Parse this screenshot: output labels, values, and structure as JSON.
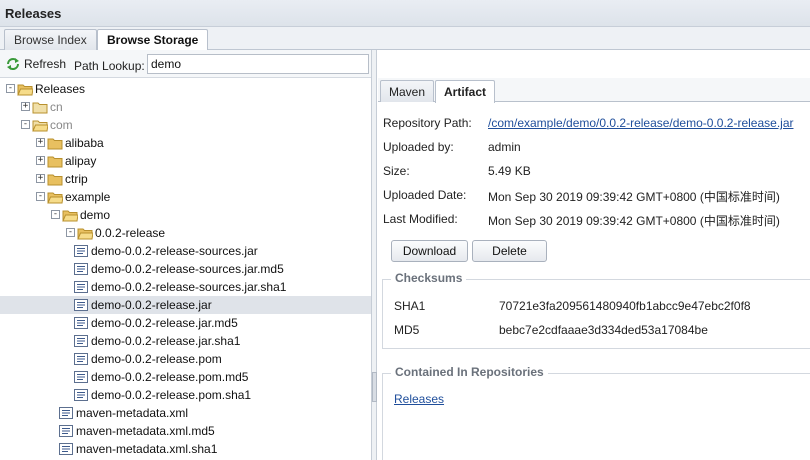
{
  "window": {
    "title": "Releases"
  },
  "main_tabs": [
    {
      "label": "Browse Index",
      "active": false
    },
    {
      "label": "Browse Storage",
      "active": true
    }
  ],
  "toolbar": {
    "refresh_label": "Refresh",
    "path_label": "Path Lookup:",
    "path_value": "demo"
  },
  "tree": [
    {
      "label": "Releases",
      "depth": 0,
      "kind": "folder-open",
      "toggle": "-",
      "dim": false,
      "selected": false
    },
    {
      "label": "cn",
      "depth": 1,
      "kind": "folder",
      "toggle": "+",
      "dim": true,
      "selected": false
    },
    {
      "label": "com",
      "depth": 1,
      "kind": "folder-open",
      "toggle": "-",
      "dim": true,
      "selected": false
    },
    {
      "label": "alibaba",
      "depth": 2,
      "kind": "folder",
      "toggle": "+",
      "dim": false,
      "selected": false
    },
    {
      "label": "alipay",
      "depth": 2,
      "kind": "folder",
      "toggle": "+",
      "dim": false,
      "selected": false
    },
    {
      "label": "ctrip",
      "depth": 2,
      "kind": "folder",
      "toggle": "+",
      "dim": false,
      "selected": false
    },
    {
      "label": "example",
      "depth": 2,
      "kind": "folder-open",
      "toggle": "-",
      "dim": false,
      "selected": false
    },
    {
      "label": "demo",
      "depth": 3,
      "kind": "folder-open",
      "toggle": "-",
      "dim": false,
      "selected": false
    },
    {
      "label": "0.0.2-release",
      "depth": 4,
      "kind": "folder-open",
      "toggle": "-",
      "dim": false,
      "selected": false
    },
    {
      "label": "demo-0.0.2-release-sources.jar",
      "depth": 5,
      "kind": "file",
      "toggle": "",
      "dim": false,
      "selected": false
    },
    {
      "label": "demo-0.0.2-release-sources.jar.md5",
      "depth": 5,
      "kind": "file",
      "toggle": "",
      "dim": false,
      "selected": false
    },
    {
      "label": "demo-0.0.2-release-sources.jar.sha1",
      "depth": 5,
      "kind": "file",
      "toggle": "",
      "dim": false,
      "selected": false
    },
    {
      "label": "demo-0.0.2-release.jar",
      "depth": 5,
      "kind": "file",
      "toggle": "",
      "dim": false,
      "selected": true
    },
    {
      "label": "demo-0.0.2-release.jar.md5",
      "depth": 5,
      "kind": "file",
      "toggle": "",
      "dim": false,
      "selected": false
    },
    {
      "label": "demo-0.0.2-release.jar.sha1",
      "depth": 5,
      "kind": "file",
      "toggle": "",
      "dim": false,
      "selected": false
    },
    {
      "label": "demo-0.0.2-release.pom",
      "depth": 5,
      "kind": "file",
      "toggle": "",
      "dim": false,
      "selected": false
    },
    {
      "label": "demo-0.0.2-release.pom.md5",
      "depth": 5,
      "kind": "file",
      "toggle": "",
      "dim": false,
      "selected": false
    },
    {
      "label": "demo-0.0.2-release.pom.sha1",
      "depth": 5,
      "kind": "file",
      "toggle": "",
      "dim": false,
      "selected": false
    },
    {
      "label": "maven-metadata.xml",
      "depth": 4,
      "kind": "file",
      "toggle": "",
      "dim": false,
      "selected": false
    },
    {
      "label": "maven-metadata.xml.md5",
      "depth": 4,
      "kind": "file",
      "toggle": "",
      "dim": false,
      "selected": false
    },
    {
      "label": "maven-metadata.xml.sha1",
      "depth": 4,
      "kind": "file",
      "toggle": "",
      "dim": false,
      "selected": false
    }
  ],
  "sub_tabs": [
    {
      "label": "Maven",
      "active": false
    },
    {
      "label": "Artifact",
      "active": true
    }
  ],
  "artifact": {
    "fields": [
      {
        "label": "Repository Path:",
        "value": "/com/example/demo/0.0.2-release/demo-0.0.2-release.jar",
        "link": true
      },
      {
        "label": "Uploaded by:",
        "value": "admin",
        "link": false
      },
      {
        "label": "Size:",
        "value": "5.49 KB",
        "link": false
      },
      {
        "label": "Uploaded Date:",
        "value": "Mon Sep 30 2019 09:39:42 GMT+0800 (中国标准时间)",
        "link": false
      },
      {
        "label": "Last Modified:",
        "value": "Mon Sep 30 2019 09:39:42 GMT+0800 (中国标准时间)",
        "link": false
      }
    ],
    "download_label": "Download",
    "delete_label": "Delete"
  },
  "checksums": {
    "title": "Checksums",
    "sha1_label": "SHA1",
    "sha1_value": "70721e3fa209561480940fb1abcc9e47ebc2f0f8",
    "md5_label": "MD5",
    "md5_value": "bebc7e2cdfaaae3d334ded53a17084be"
  },
  "contained": {
    "title": "Contained In Repositories",
    "repo_link": "Releases"
  },
  "colors": {
    "link": "#1f4e9b",
    "folder": "#e8c060",
    "selected_row": "#dfe3e9"
  }
}
